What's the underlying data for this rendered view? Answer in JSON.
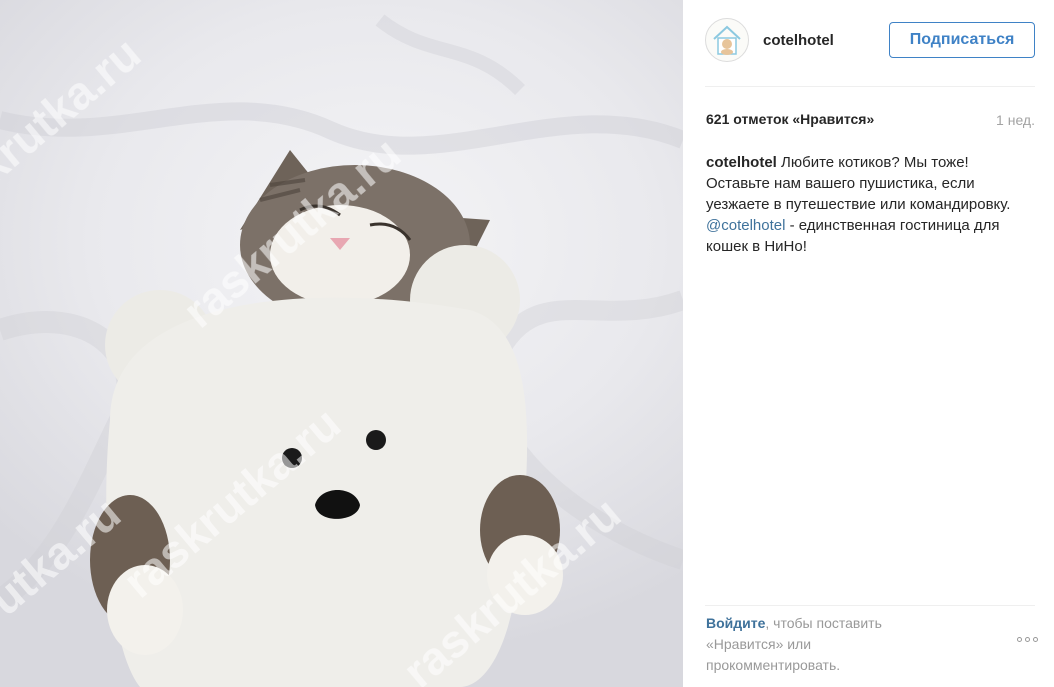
{
  "post": {
    "username": "cotelhotel",
    "follow_label": "Подписаться",
    "likes_text": "621 отметок «Нравится»",
    "time_ago": "1 нед.",
    "caption": {
      "author": "cotelhotel",
      "text_before": "Любите котиков? Мы тоже! Оставьте нам вашего пушистика, если уезжаете в путешествие или командировку.",
      "mention": "@cotelhotel",
      "text_after": "- единственная гостиница для кошек в НиНо!"
    },
    "login_prompt": {
      "link": "Войдите",
      "text": ", чтобы поставить «Нравится» или прокомментировать."
    },
    "watermark": "raskrutka.ru"
  },
  "icons": {
    "avatar": "cat-hotel-logo-icon",
    "more": "more-options-icon"
  },
  "colors": {
    "follow_blue": "#3f82c6",
    "link_blue": "#3f729b",
    "muted": "#999999"
  }
}
